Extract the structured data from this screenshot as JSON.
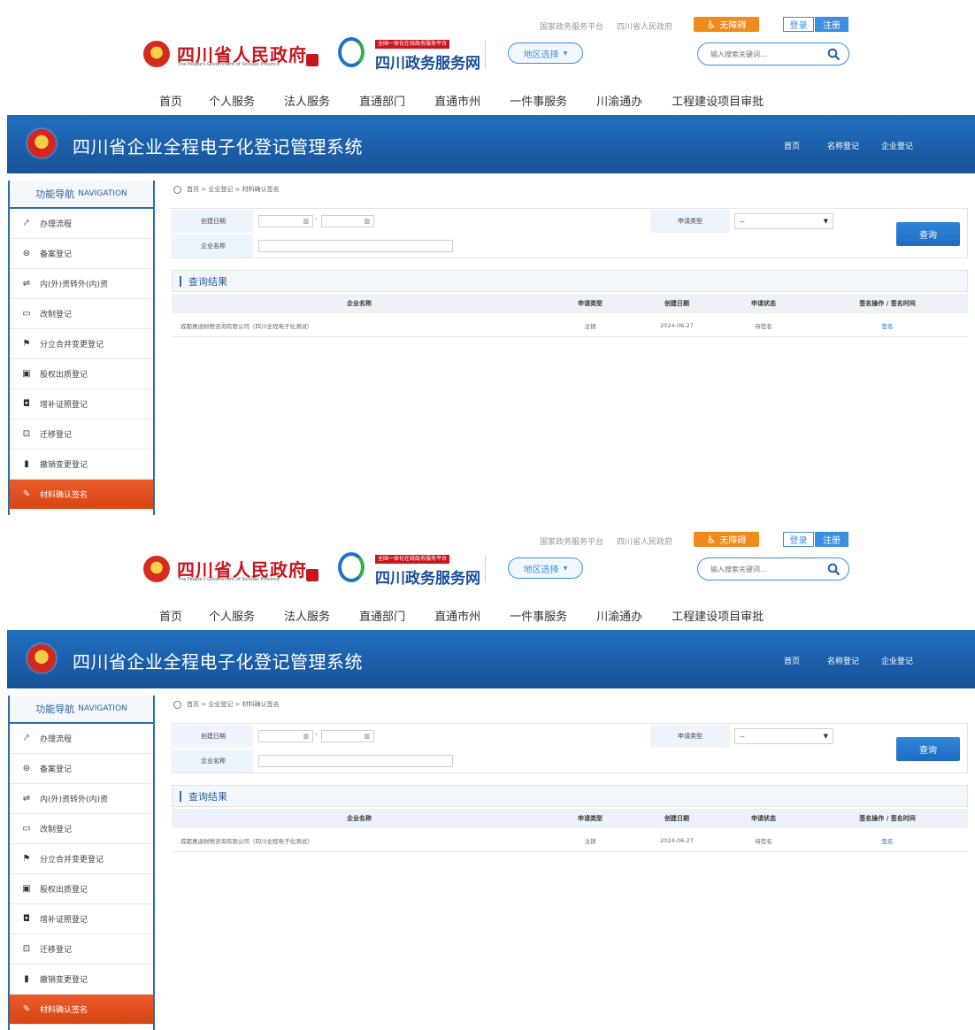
{
  "top": {
    "links": [
      "国家政务服务平台",
      "四川省人民政府"
    ],
    "accessibility": "无障碍",
    "login": "登录",
    "register": "注册",
    "gov_title": "四川省人民政府",
    "gov_subtitle": "The People's Government of Sichuan Province",
    "service_tag": "全国一体化在线政务服务平台",
    "service_title": "四川政务服务网",
    "region_select": "地区选择",
    "search_placeholder": "输入搜索关键词..."
  },
  "nav": [
    "首页",
    "个人服务",
    "法人服务",
    "直通部门",
    "直通市州",
    "一件事服务",
    "川渝通办",
    "工程建设项目审批"
  ],
  "banner": {
    "title": "四川省企业全程电子化登记管理系统",
    "links": [
      "首页",
      "名称登记",
      "企业登记"
    ]
  },
  "sidebar": {
    "header": "功能导航",
    "header_en": "NAVIGATION",
    "items": [
      {
        "label": "办理流程",
        "icon": "flow-icon"
      },
      {
        "label": "备案登记",
        "icon": "record-icon"
      },
      {
        "label": "内(外)资转外(内)资",
        "icon": "transfer-icon"
      },
      {
        "label": "改制登记",
        "icon": "monitor-icon"
      },
      {
        "label": "分立合并变更登记",
        "icon": "flag-icon"
      },
      {
        "label": "股权出质登记",
        "icon": "briefcase-icon"
      },
      {
        "label": "增补证照登记",
        "icon": "bookmark-icon"
      },
      {
        "label": "迁移登记",
        "icon": "move-icon"
      },
      {
        "label": "撤销变更登记",
        "icon": "trash-icon"
      },
      {
        "label": "材料确认签名",
        "icon": "pen-icon",
        "active": true
      }
    ]
  },
  "breadcrumb": "首页 > 企业登记 > 材料确认签名",
  "filters": {
    "created_date_label": "创建日期",
    "date_separator": "-",
    "company_name_label": "企业名称",
    "apply_type_label": "申请类型",
    "apply_type_value": "--",
    "query_button": "查询"
  },
  "results": {
    "title": "查询结果",
    "columns": [
      "企业名称",
      "申请类型",
      "创建日期",
      "申请状态",
      "签名操作 / 签名时间"
    ],
    "rows": [
      [
        "成都惠迪财税咨询有限公司（四川全程电子化测试）",
        "注销",
        "2024-06-27",
        "待签名",
        "签名"
      ]
    ]
  },
  "colors": {
    "banner_blue": "#1c5da8",
    "accent_blue": "#2c6bb3",
    "active_orange": "#e14e1e",
    "gov_red": "#c8161d",
    "access_orange": "#f08a1c"
  }
}
